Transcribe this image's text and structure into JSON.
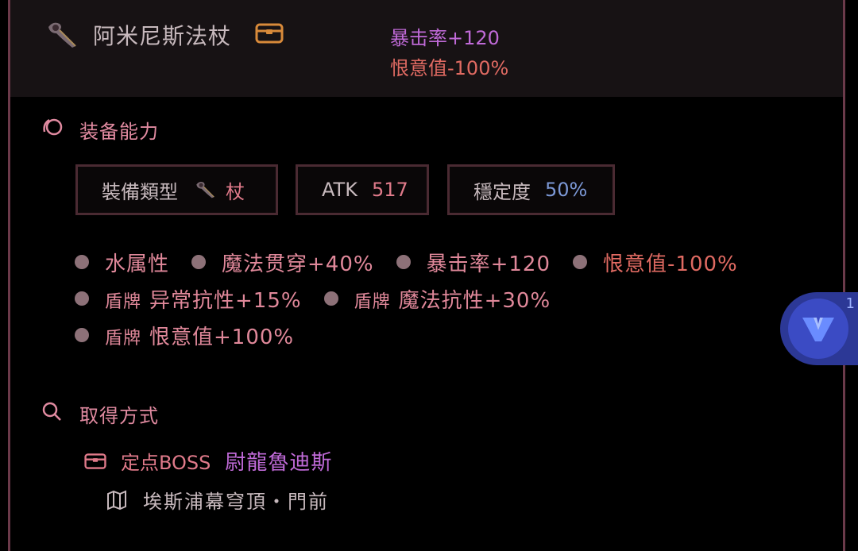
{
  "header": {
    "item_name": "阿米尼斯法杖",
    "stat_crit": "暴击率+120",
    "stat_hate": "恨意值-100%",
    "item_icon": "staff-icon",
    "box_icon": "chest-icon"
  },
  "ability": {
    "title": "装备能力",
    "icon": "swirl-icon",
    "chips": {
      "type_label": "裝備類型",
      "type_value": "杖",
      "atk_label": "ATK",
      "atk_value": "517",
      "stability_label": "穩定度",
      "stability_value": "50%"
    },
    "traits": {
      "t1": "水属性",
      "t2": "魔法贯穿+40%",
      "t3": "暴击率+120",
      "t4": "恨意值-100%",
      "t5_prefix": "盾牌",
      "t5": "异常抗性+15%",
      "t6_prefix": "盾牌",
      "t6": "魔法抗性+30%",
      "t7_prefix": "盾牌",
      "t7": "恨意值+100%"
    }
  },
  "acquire": {
    "title": "取得方式",
    "icon": "search-icon",
    "type_label": "定点BOSS",
    "boss_name": "尉龍魯迪斯",
    "location": "埃斯浦幕穹頂・門前",
    "location_icon": "map-icon"
  },
  "floating": {
    "badge_count": "1",
    "icon": "v-logo-icon"
  },
  "colors": {
    "accent_pink": "#e08aa0",
    "purple": "#c06ad8",
    "red": "#e06a62",
    "blue": "#7c98d6",
    "border": "#6b3a4a"
  }
}
